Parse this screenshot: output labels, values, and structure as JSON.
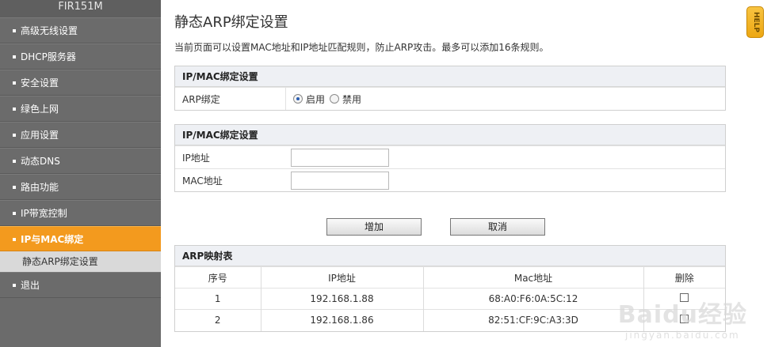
{
  "sidebar": {
    "brand": "FIR151M",
    "items": [
      {
        "label": "高级无线设置"
      },
      {
        "label": "DHCP服务器"
      },
      {
        "label": "安全设置"
      },
      {
        "label": "绿色上网"
      },
      {
        "label": "应用设置"
      },
      {
        "label": "动态DNS"
      },
      {
        "label": "路由功能"
      },
      {
        "label": "IP带宽控制"
      },
      {
        "label": "IP与MAC绑定",
        "active": true
      }
    ],
    "sub_item": "静态ARP绑定设置",
    "logout": "退出"
  },
  "page": {
    "title": "静态ARP绑定设置",
    "description": "当前页面可以设置MAC地址和IP地址匹配规则，防止ARP攻击。最多可以添加16条规则。"
  },
  "arp_panel": {
    "header": "IP/MAC绑定设置",
    "label": "ARP绑定",
    "enable_label": "启用",
    "disable_label": "禁用",
    "selected": "启用"
  },
  "bind_panel": {
    "header": "IP/MAC绑定设置",
    "ip_label": "IP地址",
    "ip_value": "",
    "mac_label": "MAC地址",
    "mac_value": ""
  },
  "buttons": {
    "add": "增加",
    "cancel": "取消"
  },
  "arp_table": {
    "header": "ARP映射表",
    "columns": [
      "序号",
      "IP地址",
      "Mac地址",
      "删除"
    ],
    "rows": [
      {
        "index": "1",
        "ip": "192.168.1.88",
        "mac": "68:A0:F6:0A:5C:12"
      },
      {
        "index": "2",
        "ip": "192.168.1.86",
        "mac": "82:51:CF:9C:A3:3D"
      }
    ]
  },
  "help": {
    "label": "HELP"
  },
  "watermark": {
    "logo": "Baidu经验",
    "sub": "jingyan.baidu.com"
  },
  "colors": {
    "active_nav": "#f39a1e",
    "sidebar": "#6b6b6b",
    "panel_header": "#eef0f4"
  }
}
